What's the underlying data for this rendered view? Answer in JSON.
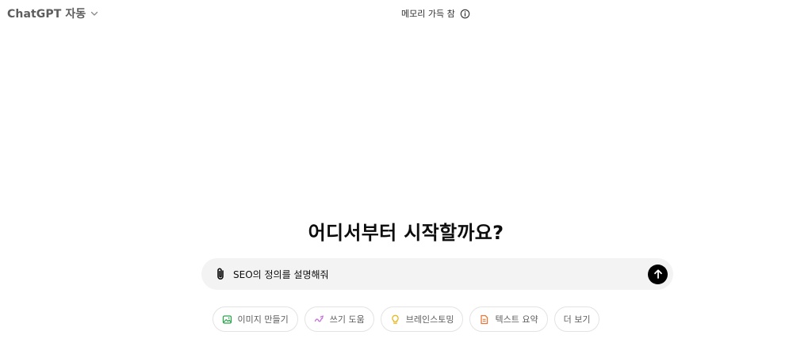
{
  "header": {
    "model_name": "ChatGPT 자동",
    "memory_status": "메모리 가득 참"
  },
  "main": {
    "headline": "어디서부터 시작할까요?"
  },
  "composer": {
    "input_value": "SEO의 정의를 설명해줘"
  },
  "suggestions": [
    {
      "label": "이미지 만들기",
      "icon": "image-icon",
      "color": "#2ea44f"
    },
    {
      "label": "쓰기 도움",
      "icon": "pen-icon",
      "color": "#c56fd6"
    },
    {
      "label": "브레인스토밍",
      "icon": "lightbulb-icon",
      "color": "#e8b923"
    },
    {
      "label": "텍스트 요약",
      "icon": "document-icon",
      "color": "#e8783a"
    },
    {
      "label": "더 보기",
      "icon": "",
      "color": ""
    }
  ],
  "colors": {
    "send_button": "#000000",
    "composer_bg": "#f3f3f3"
  }
}
